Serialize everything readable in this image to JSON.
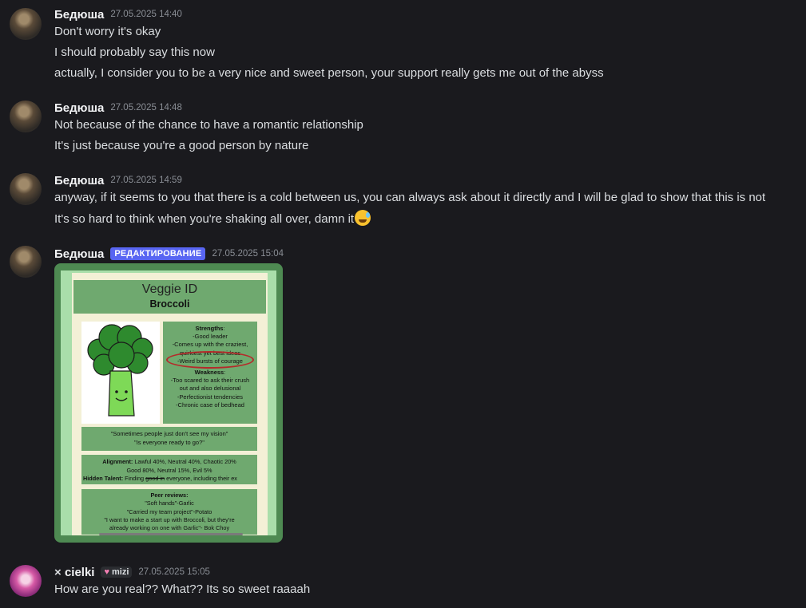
{
  "messages": [
    {
      "username": "Бедюша",
      "timestamp": "27.05.2025 14:40",
      "lines": [
        "Don't worry it's okay",
        "I should probably say this now",
        "actually, I consider you to be a very nice and sweet person, your support really gets me out of the abyss"
      ]
    },
    {
      "username": "Бедюша",
      "timestamp": "27.05.2025 14:48",
      "lines": [
        "Not because of the chance to have a romantic relationship",
        "It's just because you're a good person by nature"
      ]
    },
    {
      "username": "Бедюша",
      "timestamp": "27.05.2025 14:59",
      "lines": [
        "anyway, if it seems to you that there is a cold between us, you can always ask about it directly and I will be glad to show that this is not",
        "It's so hard to think when you're shaking all over, damn it"
      ],
      "emoji": "sweat-smile-emoji"
    },
    {
      "username": "Бедюша",
      "badge": "РЕДАКТИРОВАНИЕ",
      "timestamp": "27.05.2025 15:04",
      "image": {
        "title": "Veggie ID",
        "subtitle": "Broccoli",
        "strengths_label": "Strengths",
        "strengths": [
          "-Good leader",
          "-Comes up with the craziest,",
          "quirkiest yet best ideas",
          "-Weird bursts of courage"
        ],
        "weakness_label": "Weakness",
        "weakness": [
          "-Too scared to ask their crush",
          "out and also delusional",
          "-Perfectionist tendencies",
          "-Chronic case of bedhead"
        ],
        "quotes": [
          "\"Sometimes people just don't see my vision\"",
          "\"Is everyone ready to go?\""
        ],
        "alignment_label": "Alignment:",
        "alignment_line1": "Lawful 40%, Neutral 40%, Chaotic 20%",
        "alignment_line2": "Good 80%, Neutral 15%, Evil 5%",
        "talent_label": "Hidden Talent:",
        "talent_pre": "Finding ",
        "talent_strike": "good in",
        "talent_post": " everyone, including their ex",
        "peer_label": "Peer reviews:",
        "peer_lines": [
          "\"Soft hands\"-Garlic",
          "\"Carried my team project\"-Potato",
          "\"I want to make a start up with Broccoli, but they're",
          "already working on one with Garlic\"- Bok Choy"
        ]
      }
    },
    {
      "prefix": "×",
      "username": "cielki",
      "tag": "mizi",
      "timestamp": "27.05.2025 15:05",
      "lines": [
        "How are you real?? What?? Its so sweet raaaah"
      ]
    }
  ],
  "colors": {
    "background": "#1a1a1e",
    "username": "#f2f3f5",
    "timestamp": "#8a8e95",
    "badge": "#5865f2"
  }
}
